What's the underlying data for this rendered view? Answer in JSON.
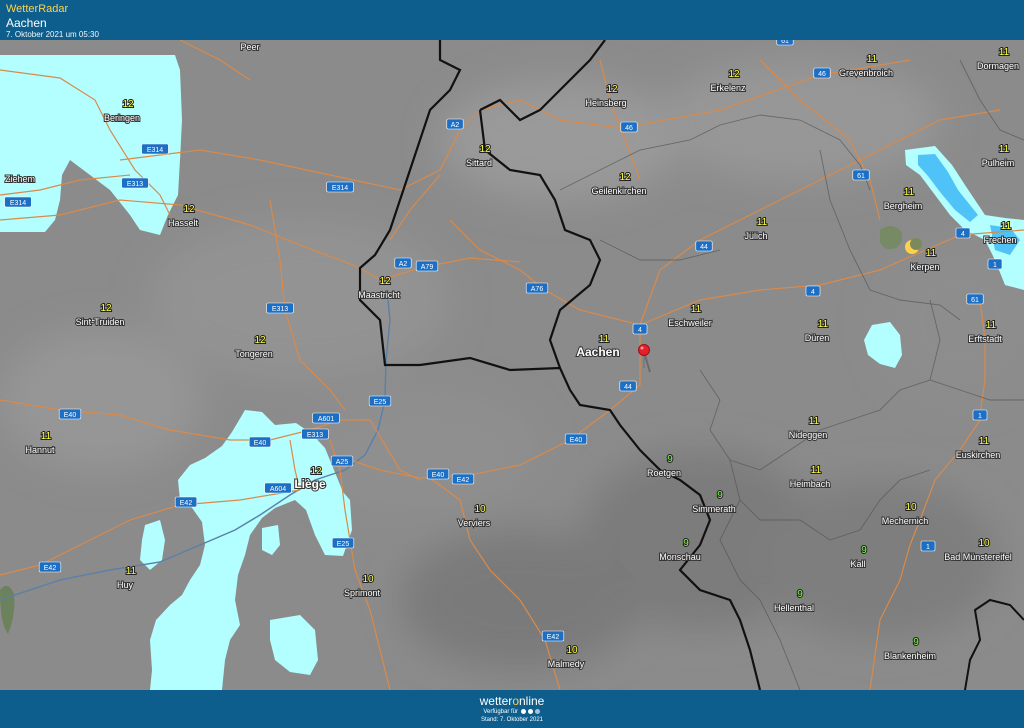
{
  "header": {
    "app_name": "WetterRadar",
    "location": "Aachen",
    "timestamp": "7. Oktober 2021 um 05:30"
  },
  "footer": {
    "brand_prefix": "wetter",
    "brand_o": "o",
    "brand_suffix": "nline",
    "availability": "Verfügbar für",
    "status": "Stand: 7. Oktober 2021"
  },
  "colors": {
    "header_bg": "#0d5e8c",
    "app_name": "#ffd24a",
    "rain_light": "#b3ffff",
    "rain_medium": "#4fc3f7",
    "temp_label": "#ffff3b",
    "temp_label_cool": "#7dff4a",
    "road_shield": "#1c6fc4",
    "road_line": "#d98a4a",
    "border_line": "#111111"
  },
  "cities": [
    {
      "name": "Peer",
      "temp": ""
    },
    {
      "name": "Beringen",
      "temp": "12"
    },
    {
      "name": "Ziehem",
      "temp": ""
    },
    {
      "name": "Hasselt",
      "temp": "12"
    },
    {
      "name": "Sint-Truiden",
      "temp": "12"
    },
    {
      "name": "Tongeren",
      "temp": "12"
    },
    {
      "name": "Hannut",
      "temp": "11"
    },
    {
      "name": "Liège",
      "temp": "12"
    },
    {
      "name": "Huy",
      "temp": "11"
    },
    {
      "name": "Sprimont",
      "temp": "10"
    },
    {
      "name": "Verviers",
      "temp": "10"
    },
    {
      "name": "Malmedy",
      "temp": "10"
    },
    {
      "name": "Maastricht",
      "temp": "12"
    },
    {
      "name": "Sittard",
      "temp": "12"
    },
    {
      "name": "Heinsberg",
      "temp": "12"
    },
    {
      "name": "Geilenkirchen",
      "temp": "12"
    },
    {
      "name": "Erkelenz",
      "temp": "12"
    },
    {
      "name": "Jülich",
      "temp": "11"
    },
    {
      "name": "Aachen",
      "temp": "11"
    },
    {
      "name": "Eschweiler",
      "temp": "11"
    },
    {
      "name": "Düren",
      "temp": "11"
    },
    {
      "name": "Roetgen",
      "temp": "9"
    },
    {
      "name": "Simmerath",
      "temp": "9"
    },
    {
      "name": "Monschau",
      "temp": "9"
    },
    {
      "name": "Nideggen",
      "temp": "11"
    },
    {
      "name": "Heimbach",
      "temp": "11"
    },
    {
      "name": "Hellenthal",
      "temp": "9"
    },
    {
      "name": "Mechernich",
      "temp": "10"
    },
    {
      "name": "Kall",
      "temp": "9"
    },
    {
      "name": "Blankenheim",
      "temp": "9"
    },
    {
      "name": "Bad Münstereifel",
      "temp": "10"
    },
    {
      "name": "Euskirchen",
      "temp": "11"
    },
    {
      "name": "Erftstadt",
      "temp": "11"
    },
    {
      "name": "Kerpen",
      "temp": "11"
    },
    {
      "name": "Bergheim",
      "temp": "11"
    },
    {
      "name": "Frechen",
      "temp": "11"
    },
    {
      "name": "Pulheim",
      "temp": "11"
    },
    {
      "name": "Grevenbroich",
      "temp": "11"
    },
    {
      "name": "Dormagen",
      "temp": "11"
    }
  ],
  "roads": [
    "61",
    "46",
    "46",
    "A2",
    "E314",
    "E314",
    "E313",
    "E314",
    "A2",
    "A79",
    "A76",
    "E313",
    "44",
    "4",
    "4",
    "61",
    "4",
    "1",
    "61",
    "1",
    "1",
    "E25",
    "A601",
    "E40",
    "E313",
    "E40",
    "A25",
    "E40",
    "E40",
    "E42",
    "A604",
    "E42",
    "E25",
    "E42",
    "E42",
    "44",
    "E40"
  ]
}
